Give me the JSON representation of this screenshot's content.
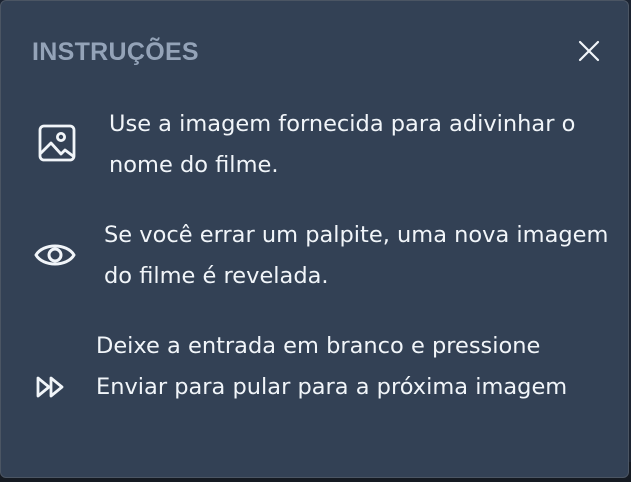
{
  "modal": {
    "title": "INSTRUÇÕES",
    "close_icon": "close-icon"
  },
  "instructions": [
    {
      "icon": "image-icon",
      "text": "Use a imagem fornecida para adivinhar o nome do filme."
    },
    {
      "icon": "eye-icon",
      "text": "Se você errar um palpite, uma nova imagem do filme é revelada."
    },
    {
      "icon": "fast-forward-icon",
      "text": "Deixe a entrada em branco e pressione Enviar para pular para a próxima imagem"
    }
  ],
  "colors": {
    "modal_bg": "#334155",
    "title": "#94a3b8",
    "text": "#f1f5f9",
    "icon": "#f1f5f9"
  }
}
